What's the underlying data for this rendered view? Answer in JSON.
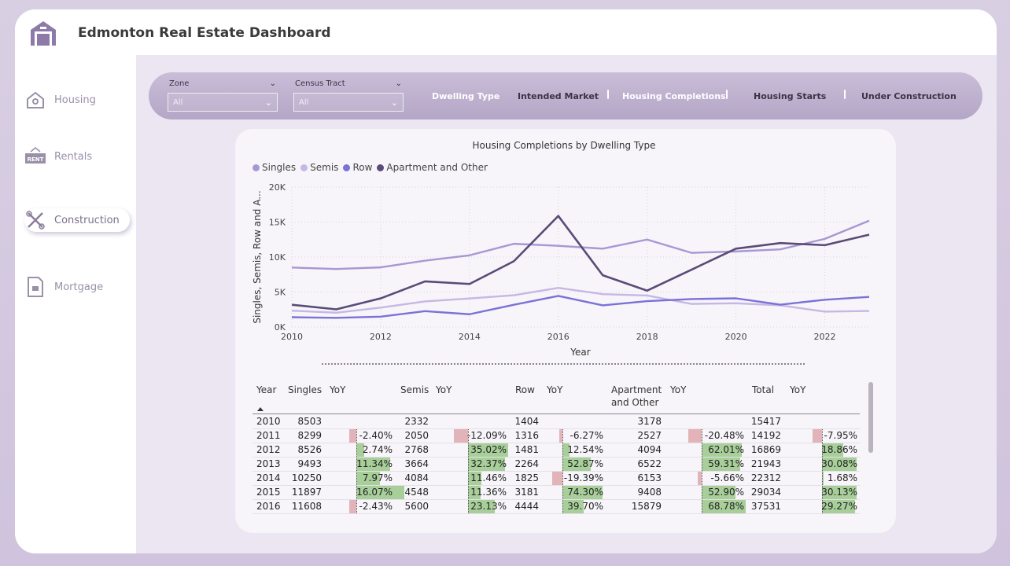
{
  "app": {
    "title": "Edmonton Real Estate Dashboard"
  },
  "sidebar": {
    "items": [
      {
        "label": "Housing",
        "icon": "house-icon",
        "active": false
      },
      {
        "label": "Rentals",
        "icon": "rent-sign-icon",
        "active": false
      },
      {
        "label": "Construction",
        "icon": "tools-icon",
        "active": true
      },
      {
        "label": "Mortgage",
        "icon": "document-icon",
        "active": false
      }
    ]
  },
  "filters": {
    "zone": {
      "label": "Zone",
      "value": "All"
    },
    "census": {
      "label": "Census Tract",
      "value": "All"
    },
    "tabs": [
      "Dwelling Type",
      "Intended Market",
      "Housing Completions",
      "Housing Starts",
      "Under Construction"
    ]
  },
  "colors": {
    "singles": "#a797d3",
    "semis": "#c6b7e4",
    "row": "#7a72d6",
    "apartment": "#5a4b78",
    "pos_bar": "#a8cf9a",
    "neg_bar": "#e2b4b9"
  },
  "chart_data": {
    "type": "line",
    "title": "Housing Completions by Dwelling Type",
    "xlabel": "Year",
    "ylabel": "Singles, Semis, Row and A...",
    "x": [
      2010,
      2011,
      2012,
      2013,
      2014,
      2015,
      2016,
      2017,
      2018,
      2019,
      2020,
      2021,
      2022,
      2023
    ],
    "xticks": [
      "2010",
      "2012",
      "2014",
      "2016",
      "2018",
      "2020",
      "2022"
    ],
    "yticks": [
      "0K",
      "5K",
      "10K",
      "15K",
      "20K"
    ],
    "ylim": [
      0,
      20000
    ],
    "grid": true,
    "legend_position": "top-left",
    "series": [
      {
        "name": "Singles",
        "values": [
          8503,
          8299,
          8526,
          9493,
          10250,
          11897,
          11608,
          11200,
          12500,
          10600,
          10800,
          11100,
          12600,
          15200
        ]
      },
      {
        "name": "Semis",
        "values": [
          2332,
          2050,
          2768,
          3664,
          4084,
          4548,
          5600,
          4700,
          4500,
          3300,
          3400,
          3100,
          2200,
          2300
        ]
      },
      {
        "name": "Row",
        "values": [
          1404,
          1316,
          1481,
          2264,
          1825,
          3181,
          4444,
          3100,
          3700,
          4000,
          4100,
          3200,
          3900,
          4300
        ]
      },
      {
        "name": "Apartment and Other",
        "values": [
          3178,
          2527,
          4094,
          6522,
          6153,
          9408,
          15879,
          7400,
          5200,
          8200,
          11200,
          12000,
          11700,
          13200
        ]
      }
    ]
  },
  "table": {
    "headers": [
      "Year",
      "Singles",
      "YoY",
      "Semis",
      "YoY",
      "Row",
      "YoY",
      "Apartment and Other",
      "YoY",
      "Total",
      "YoY"
    ],
    "rows": [
      {
        "year": "2010",
        "singles": "8503",
        "s_yoy": "",
        "semis": "2332",
        "se_yoy": "",
        "row": "1404",
        "r_yoy": "",
        "apt": "3178",
        "a_yoy": "",
        "total": "15417",
        "t_yoy": ""
      },
      {
        "year": "2011",
        "singles": "8299",
        "s_yoy": "-2.40%",
        "semis": "2050",
        "se_yoy": "-12.09%",
        "row": "1316",
        "r_yoy": "-6.27%",
        "apt": "2527",
        "a_yoy": "-20.48%",
        "total": "14192",
        "t_yoy": "-7.95%"
      },
      {
        "year": "2012",
        "singles": "8526",
        "s_yoy": "2.74%",
        "semis": "2768",
        "se_yoy": "35.02%",
        "row": "1481",
        "r_yoy": "12.54%",
        "apt": "4094",
        "a_yoy": "62.01%",
        "total": "16869",
        "t_yoy": "18.86%"
      },
      {
        "year": "2013",
        "singles": "9493",
        "s_yoy": "11.34%",
        "semis": "3664",
        "se_yoy": "32.37%",
        "row": "2264",
        "r_yoy": "52.87%",
        "apt": "6522",
        "a_yoy": "59.31%",
        "total": "21943",
        "t_yoy": "30.08%"
      },
      {
        "year": "2014",
        "singles": "10250",
        "s_yoy": "7.97%",
        "semis": "4084",
        "se_yoy": "11.46%",
        "row": "1825",
        "r_yoy": "-19.39%",
        "apt": "6153",
        "a_yoy": "-5.66%",
        "total": "22312",
        "t_yoy": "1.68%"
      },
      {
        "year": "2015",
        "singles": "11897",
        "s_yoy": "16.07%",
        "semis": "4548",
        "se_yoy": "11.36%",
        "row": "3181",
        "r_yoy": "74.30%",
        "apt": "9408",
        "a_yoy": "52.90%",
        "total": "29034",
        "t_yoy": "30.13%"
      },
      {
        "year": "2016",
        "singles": "11608",
        "s_yoy": "-2.43%",
        "semis": "5600",
        "se_yoy": "23.13%",
        "row": "4444",
        "r_yoy": "39.70%",
        "apt": "15879",
        "a_yoy": "68.78%",
        "total": "37531",
        "t_yoy": "29.27%"
      }
    ]
  }
}
